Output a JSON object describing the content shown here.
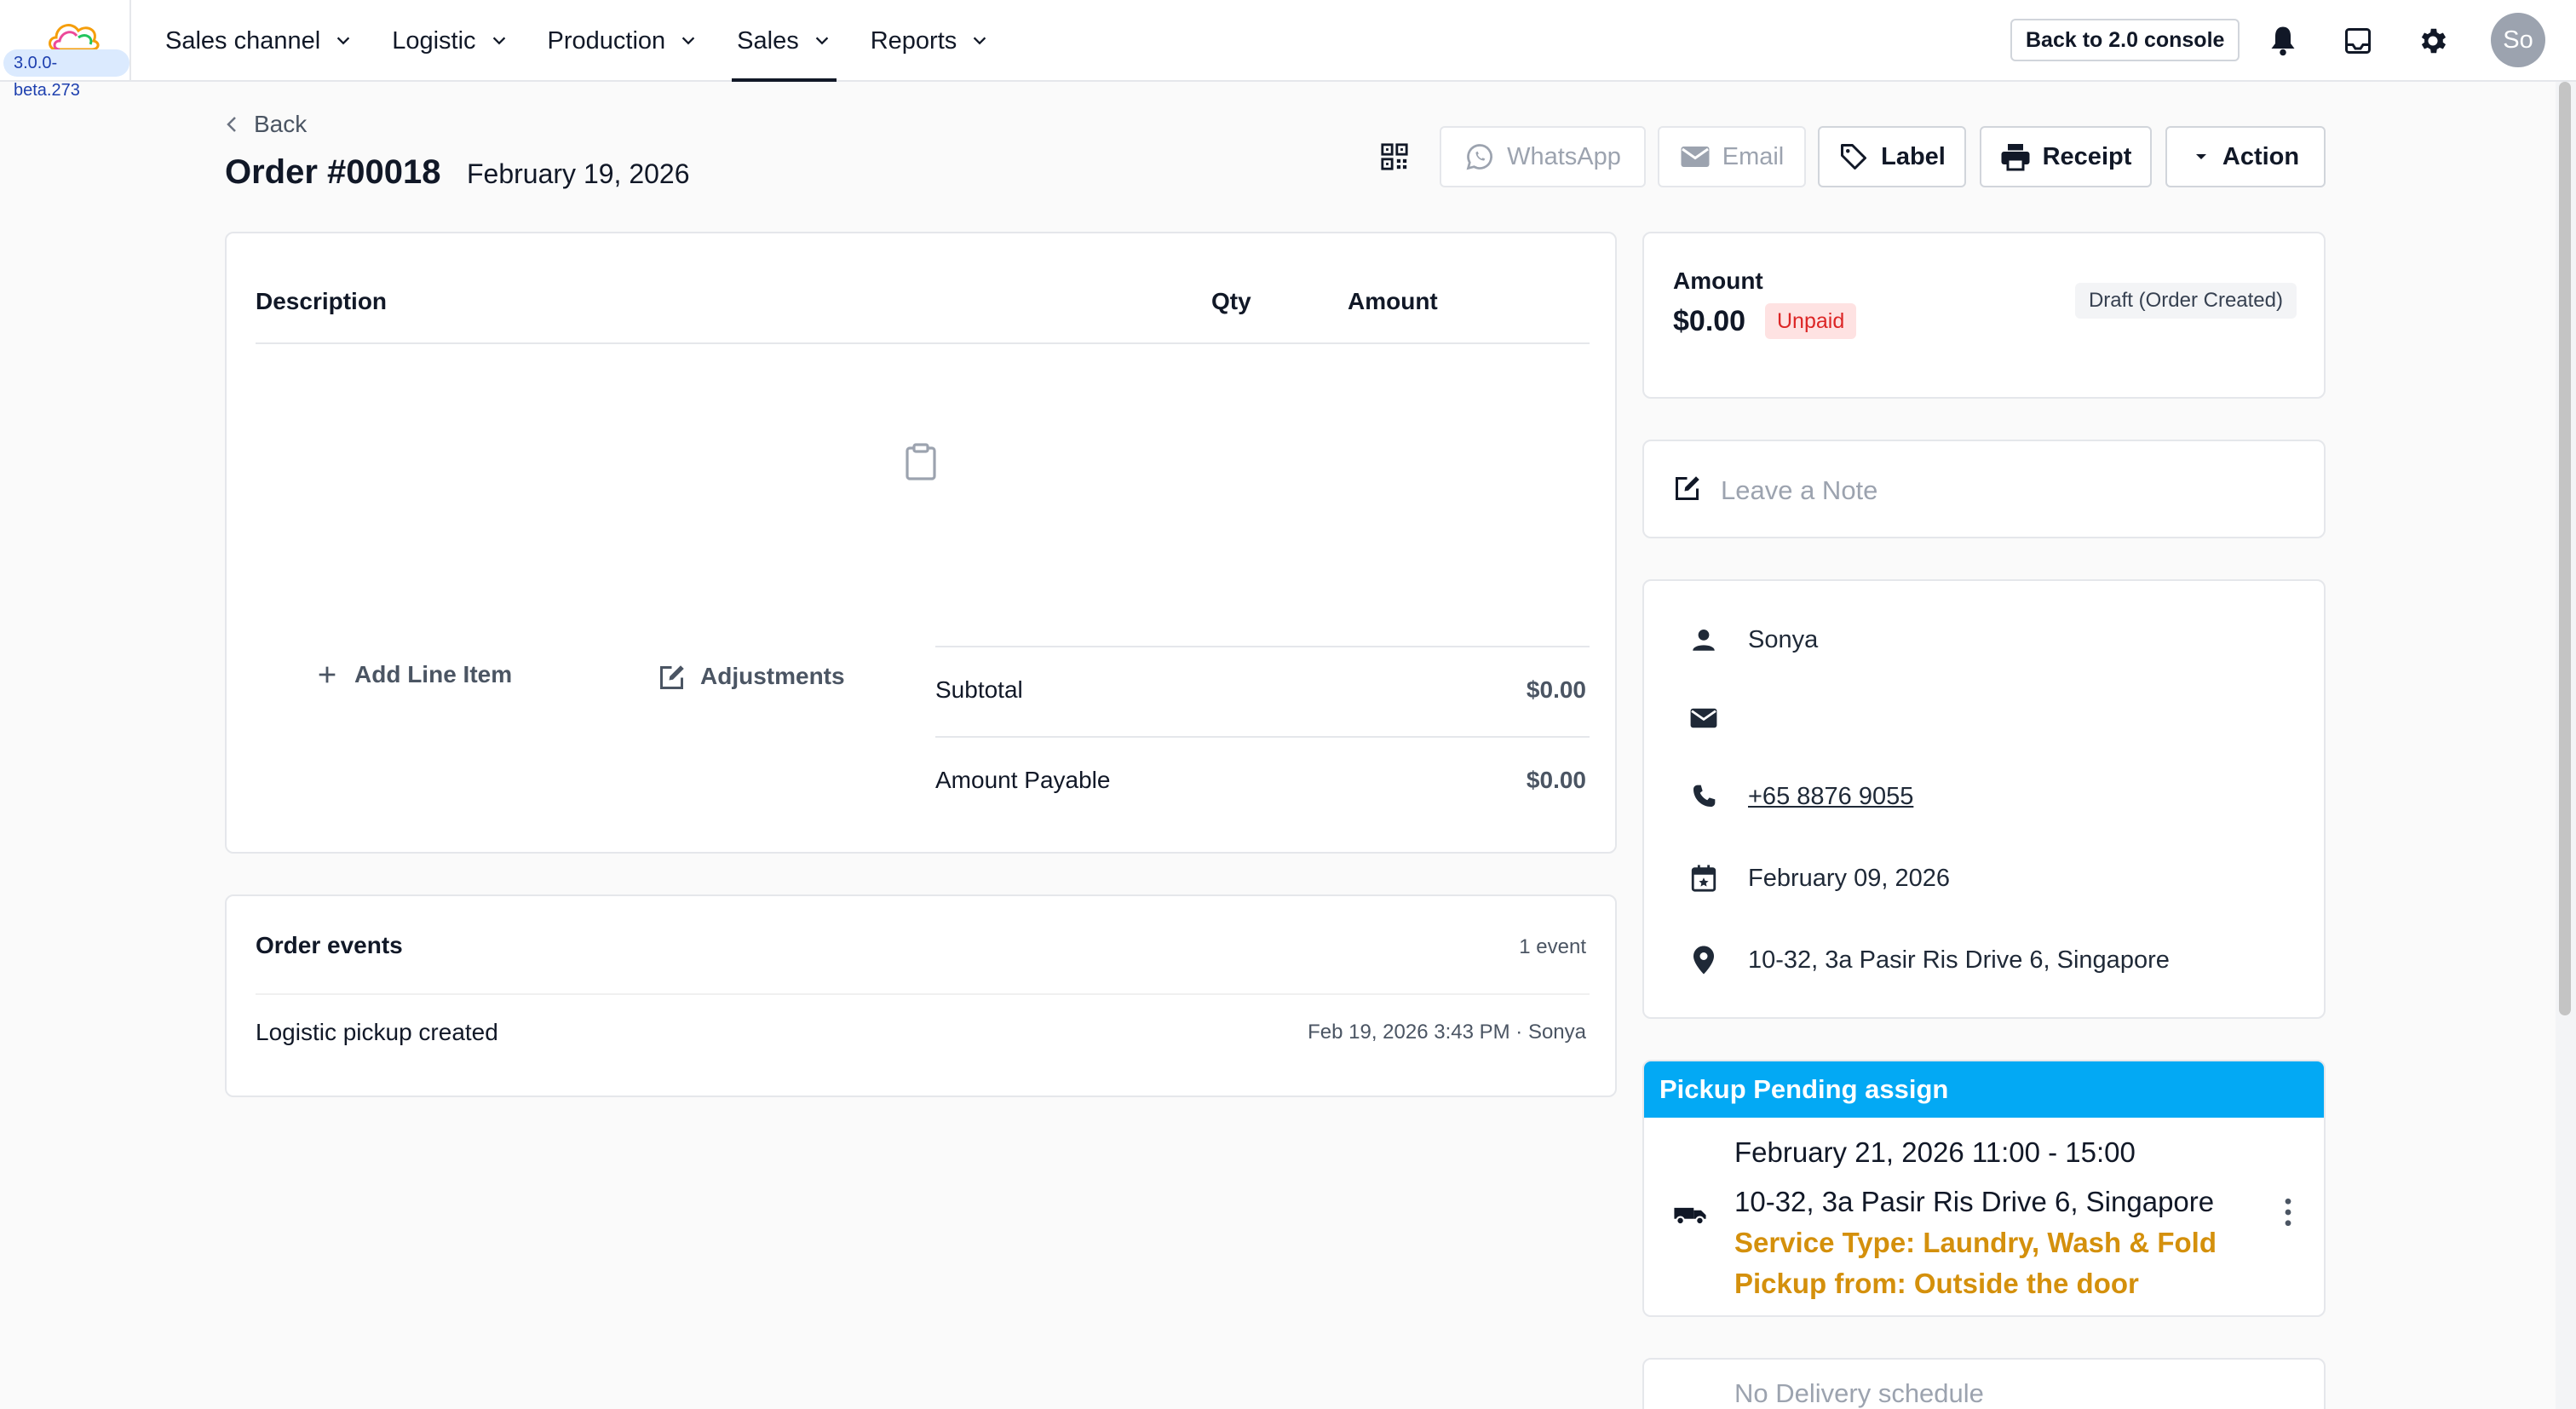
{
  "app": {
    "version": "3.0.0-beta.273"
  },
  "nav": {
    "items": [
      {
        "label": "Sales channel"
      },
      {
        "label": "Logistic"
      },
      {
        "label": "Production"
      },
      {
        "label": "Sales",
        "active": true
      },
      {
        "label": "Reports"
      }
    ],
    "console_button": "Back to 2.0 console",
    "avatar_initials": "So",
    "icons": [
      "bell-icon",
      "inbox-icon",
      "gear-icon"
    ]
  },
  "header": {
    "back_label": "Back",
    "order_title": "Order #00018",
    "order_date": "February 19, 2026",
    "buttons": {
      "whatsapp": "WhatsApp",
      "email": "Email",
      "label": "Label",
      "receipt": "Receipt",
      "action": "Action"
    }
  },
  "items": {
    "columns": {
      "description": "Description",
      "qty": "Qty",
      "amount": "Amount"
    },
    "rows": [],
    "add_line_item": "Add Line Item",
    "adjustments": "Adjustments",
    "subtotal_label": "Subtotal",
    "subtotal_value": "$0.00",
    "payable_label": "Amount Payable",
    "payable_value": "$0.00"
  },
  "events": {
    "title": "Order events",
    "count": "1 event",
    "list": [
      {
        "text": "Logistic pickup created",
        "meta": "Feb 19, 2026 3:43 PM · Sonya"
      }
    ]
  },
  "amount": {
    "label": "Amount",
    "value": "$0.00",
    "payment_status": "Unpaid",
    "order_status": "Draft (Order Created)"
  },
  "note": {
    "placeholder": "Leave a Note"
  },
  "contact": {
    "name": "Sonya",
    "email": "",
    "phone": "+65 8876 9055",
    "date": "February 09, 2026",
    "address": "10-32, 3a Pasir Ris Drive 6, Singapore"
  },
  "pickup": {
    "header": "Pickup Pending assign",
    "schedule": "February 21, 2026 11:00 - 15:00",
    "address": "10-32, 3a Pasir Ris Drive 6, Singapore",
    "service_type": "Service Type: Laundry, Wash & Fold",
    "pickup_from": "Pickup from: Outside the door"
  },
  "delivery": {
    "text": "No Delivery schedule"
  },
  "colors": {
    "pickup_header": "#03a9f4",
    "accent_text": "#d4900c",
    "unpaid_bg": "#fee2e2",
    "unpaid_text": "#dc2626"
  }
}
